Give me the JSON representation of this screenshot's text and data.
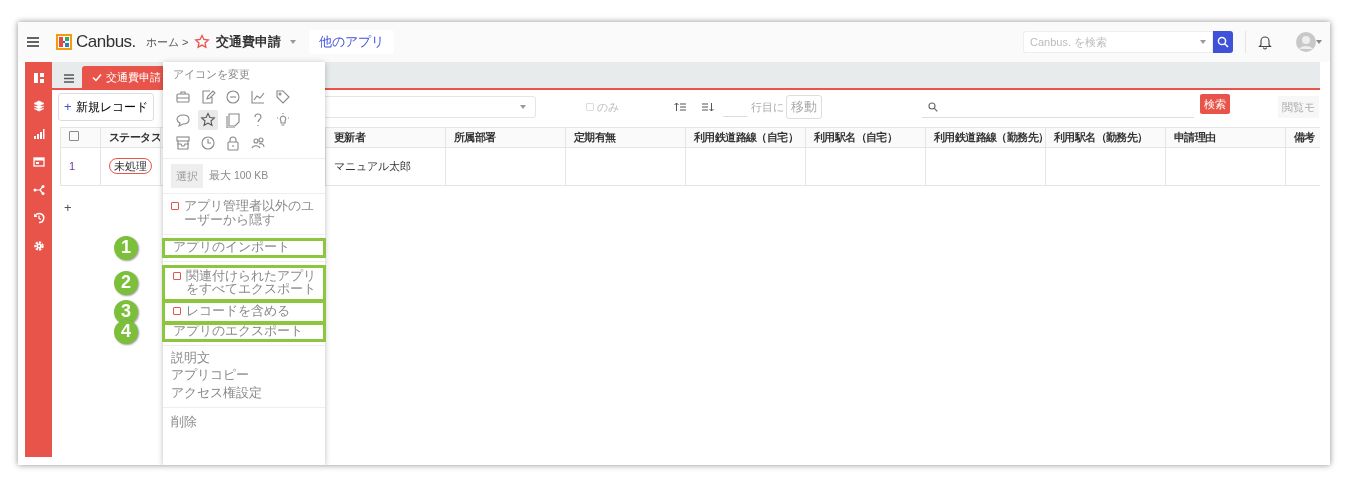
{
  "top_bar": {
    "logo_text": "Canbus.",
    "breadcrumb": "ホーム >",
    "app_title": "交通費申請",
    "other_apps_button": "他のアプリ",
    "search": {
      "placeholder": "Canbus. を検索"
    }
  },
  "tab": {
    "label": "交通費申請",
    "selected": true
  },
  "toolbar": {
    "new_record_icon": "+",
    "new_record_button": "新規レコード",
    "only_checkbox": {
      "label": "のみ",
      "checked": false
    },
    "row_suffix": "行目に",
    "move_button": "移動",
    "search_button": "検索",
    "view_mode_button": "閲覧モ"
  },
  "table": {
    "header_checkbox": {
      "checked": false
    },
    "columns": [
      "ステータス",
      "更新者",
      "所属部署",
      "定期有無",
      "利用鉄道路線（自宅）",
      "利用駅名（自宅）",
      "利用鉄道路線（勤務先）",
      "利用駅名（勤務先）",
      "申請理由",
      "備考"
    ],
    "rows": [
      {
        "number": "1",
        "status": "未処理",
        "updater": "マニュアル太郎"
      }
    ],
    "add_row": "+"
  },
  "menu": {
    "icon_label": "アイコンを変更",
    "icon_choices": [
      {
        "selected": false
      },
      {
        "selected": false
      },
      {
        "selected": false
      },
      {
        "selected": false
      },
      {
        "selected": false
      },
      {
        "selected": false
      },
      {
        "selected": true
      },
      {
        "selected": false
      },
      {
        "selected": false
      },
      {
        "selected": false
      },
      {
        "selected": false
      },
      {
        "selected": false
      },
      {
        "selected": false
      },
      {
        "selected": false
      }
    ],
    "upload": {
      "button": "選択",
      "note": "最大 100 KB"
    },
    "sections": [
      [
        {
          "kind": "checkbox",
          "label": "アプリ管理者以外のユーザーから隠す",
          "checked": false
        }
      ],
      [
        {
          "kind": "action",
          "label": "アプリのインポート",
          "callout": "1"
        }
      ],
      [
        {
          "kind": "checkbox",
          "label": "関連付けられたアプリをすべてエクスポート",
          "checked": false,
          "callout": "2"
        },
        {
          "kind": "checkbox",
          "label": "レコードを含める",
          "checked": false,
          "callout": "3"
        },
        {
          "kind": "action",
          "label": "アプリのエクスポート",
          "callout": "4"
        }
      ],
      [
        {
          "kind": "action",
          "label": "説明文"
        },
        {
          "kind": "action",
          "label": "アプリコピー"
        },
        {
          "kind": "action",
          "label": "アクセス権設定"
        }
      ],
      [
        {
          "kind": "action",
          "label": "削除"
        }
      ]
    ]
  }
}
